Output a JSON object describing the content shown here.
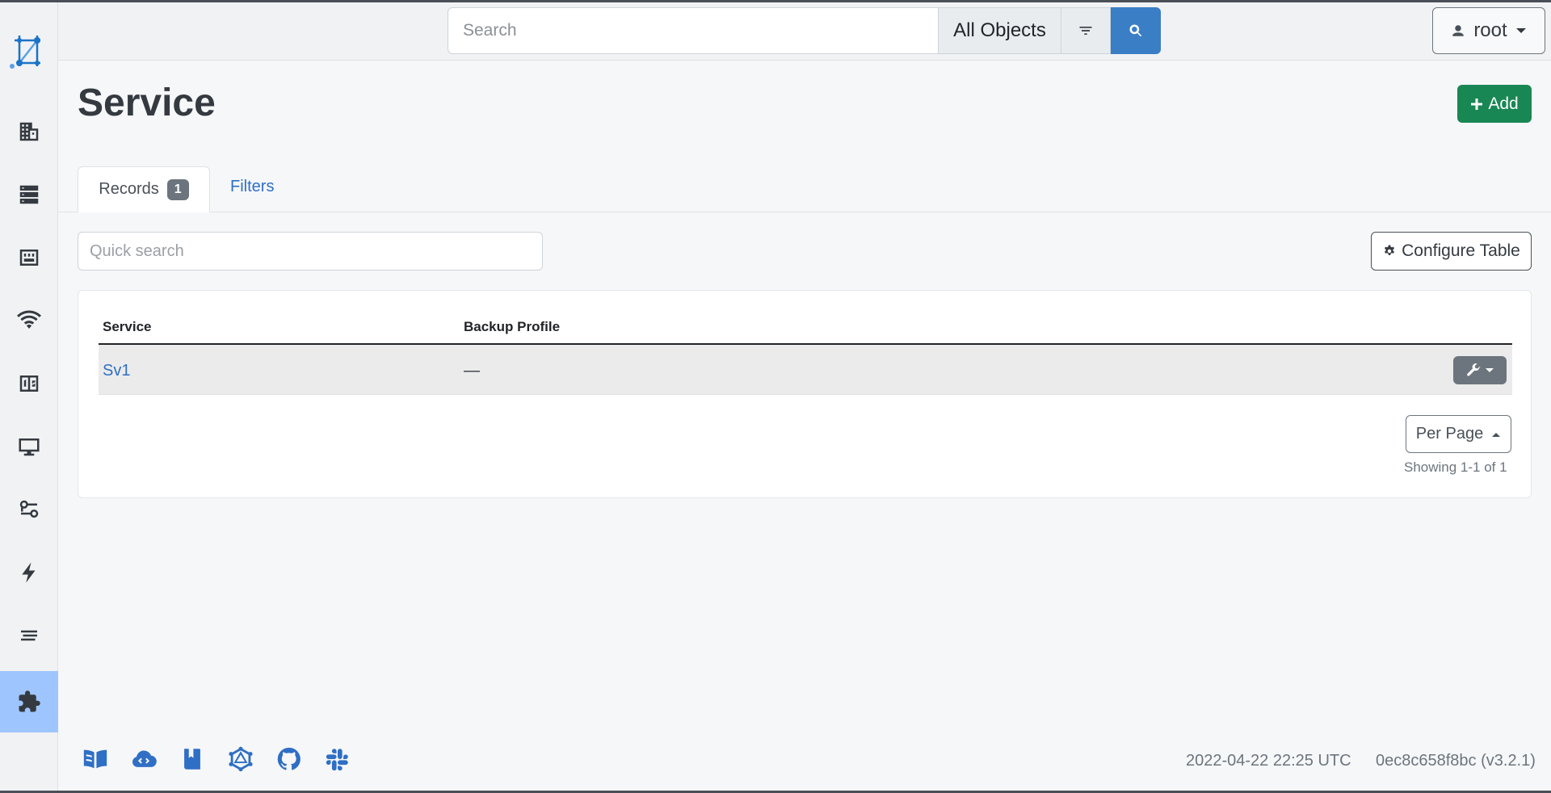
{
  "header": {
    "search_placeholder": "Search",
    "object_filter": "All Objects",
    "user": "root"
  },
  "sidebar": {
    "icons": [
      "organization-icon",
      "devices-icon",
      "dcim-icon",
      "wireless-icon",
      "ipam-icon",
      "virtualization-icon",
      "circuits-icon",
      "power-icon",
      "other-icon",
      "plugins-icon"
    ],
    "active": "plugins-icon"
  },
  "page": {
    "title": "Service",
    "add_label": "Add"
  },
  "tabs": {
    "records_label": "Records",
    "records_count": "1",
    "filters_label": "Filters"
  },
  "toolbar": {
    "quick_search_placeholder": "Quick search",
    "configure_label": "Configure Table"
  },
  "table": {
    "columns": [
      "Service",
      "Backup Profile"
    ],
    "rows": [
      {
        "service": "Sv1",
        "backup_profile": "—"
      }
    ]
  },
  "pagination": {
    "per_page_label": "Per Page",
    "showing": "Showing 1-1 of 1"
  },
  "footer": {
    "timestamp": "2022-04-22 22:25 UTC",
    "version": "0ec8c658f8bc (v3.2.1)"
  },
  "colors": {
    "primary": "#3a7ec6",
    "success": "#198754",
    "link": "#2f6fc5",
    "active_sidebar": "#9ec5fe"
  }
}
